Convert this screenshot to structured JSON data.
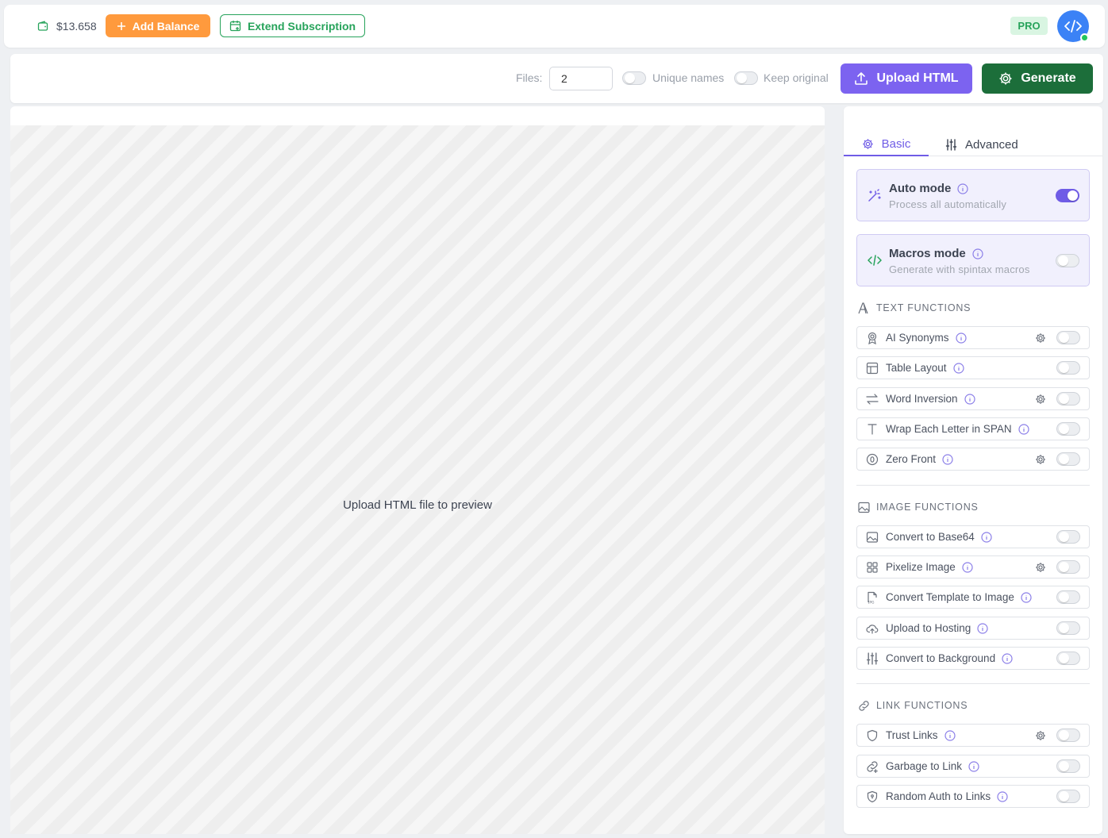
{
  "header": {
    "balance": "$13.658",
    "add_balance_label": "Add Balance",
    "extend_subscription_label": "Extend Subscription",
    "plan_badge": "PRO"
  },
  "toolbar": {
    "files_label": "Files:",
    "files_value": "2",
    "unique_names_label": "Unique names",
    "keep_original_label": "Keep original",
    "upload_label": "Upload HTML",
    "generate_label": "Generate"
  },
  "preview": {
    "placeholder": "Upload HTML file to preview"
  },
  "panel": {
    "tabs": [
      {
        "label": "Basic",
        "active": true
      },
      {
        "label": "Advanced",
        "active": false
      }
    ],
    "modes": [
      {
        "title": "Auto mode",
        "subtitle": "Process all automatically",
        "enabled": true
      },
      {
        "title": "Macros mode",
        "subtitle": "Generate with spintax macros",
        "enabled": false
      }
    ],
    "sections": [
      {
        "title": "TEXT FUNCTIONS",
        "items": [
          {
            "label": "AI Synonyms",
            "icon": "award-icon",
            "settings": true,
            "enabled": false
          },
          {
            "label": "Table Layout",
            "icon": "table-icon",
            "settings": false,
            "enabled": false
          },
          {
            "label": "Word Inversion",
            "icon": "swap-icon",
            "settings": true,
            "enabled": false
          },
          {
            "label": "Wrap Each Letter in SPAN",
            "icon": "type-icon",
            "settings": false,
            "enabled": false
          },
          {
            "label": "Zero Front",
            "icon": "zero-icon",
            "settings": true,
            "enabled": false
          }
        ]
      },
      {
        "title": "IMAGE FUNCTIONS",
        "items": [
          {
            "label": "Convert to Base64",
            "icon": "image-icon",
            "settings": false,
            "enabled": false
          },
          {
            "label": "Pixelize Image",
            "icon": "grid-icon",
            "settings": true,
            "enabled": false
          },
          {
            "label": "Convert Template to Image",
            "icon": "jpg-file-icon",
            "settings": false,
            "enabled": false
          },
          {
            "label": "Upload to Hosting",
            "icon": "cloud-upload-icon",
            "settings": false,
            "enabled": false
          },
          {
            "label": "Convert to Background",
            "icon": "sliders-icon",
            "settings": false,
            "enabled": false
          }
        ]
      },
      {
        "title": "LINK FUNCTIONS",
        "items": [
          {
            "label": "Trust Links",
            "icon": "shield-icon",
            "settings": true,
            "enabled": false
          },
          {
            "label": "Garbage to Link",
            "icon": "link-plus-icon",
            "settings": false,
            "enabled": false
          },
          {
            "label": "Random Auth to Links",
            "icon": "shield-lock-icon",
            "settings": false,
            "enabled": false
          }
        ]
      }
    ]
  },
  "colors": {
    "accent": "#6f5ce6",
    "orange": "#ff9a3d",
    "green": "#27a35b",
    "dark_green": "#1c6e3a"
  }
}
